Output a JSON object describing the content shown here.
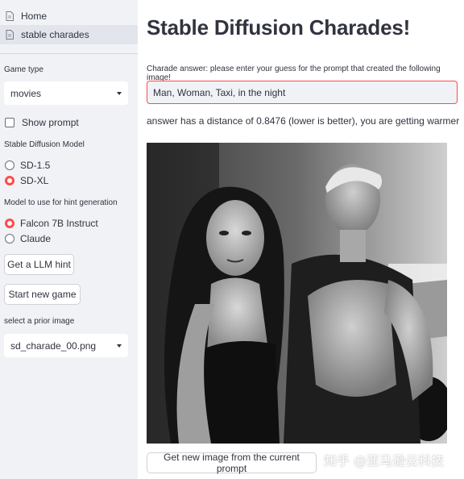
{
  "sidebar": {
    "nav": [
      {
        "label": "Home",
        "icon": "document-icon",
        "active": false
      },
      {
        "label": "stable charades",
        "icon": "document-icon",
        "active": true
      }
    ],
    "game_type": {
      "label": "Game type",
      "value": "movies"
    },
    "show_prompt": {
      "label": "Show prompt",
      "checked": false
    },
    "sd_model": {
      "label": "Stable Diffusion Model",
      "options": [
        {
          "label": "SD-1.5",
          "selected": false
        },
        {
          "label": "SD-XL",
          "selected": true
        }
      ]
    },
    "hint_model": {
      "label": "Model to use for hint generation",
      "options": [
        {
          "label": "Falcon 7B Instruct",
          "selected": true
        },
        {
          "label": "Claude",
          "selected": false
        }
      ]
    },
    "hint_button": "Get a LLM hint",
    "new_game_button": "Start new game",
    "prior_image": {
      "label": "select a prior image",
      "value": "sd_charade_00.png"
    }
  },
  "main": {
    "title": "Stable Diffusion Charades!",
    "input_label": "Charade answer: please enter your guess for the prompt that created the following image!",
    "input_value": "Man, Woman, Taxi, in the night",
    "distance_text": "answer has a distance of 0.8476 (lower is better), you are getting warmer",
    "image_alt": "Black and white photo of a woman and a man posing in front of a car",
    "new_image_button": "Get new image from the current prompt"
  },
  "watermark": "知乎 @亚马逊云科技",
  "colors": {
    "accent": "#ff4b4b",
    "sidebar_bg": "#f0f2f6",
    "text": "#31333f"
  }
}
